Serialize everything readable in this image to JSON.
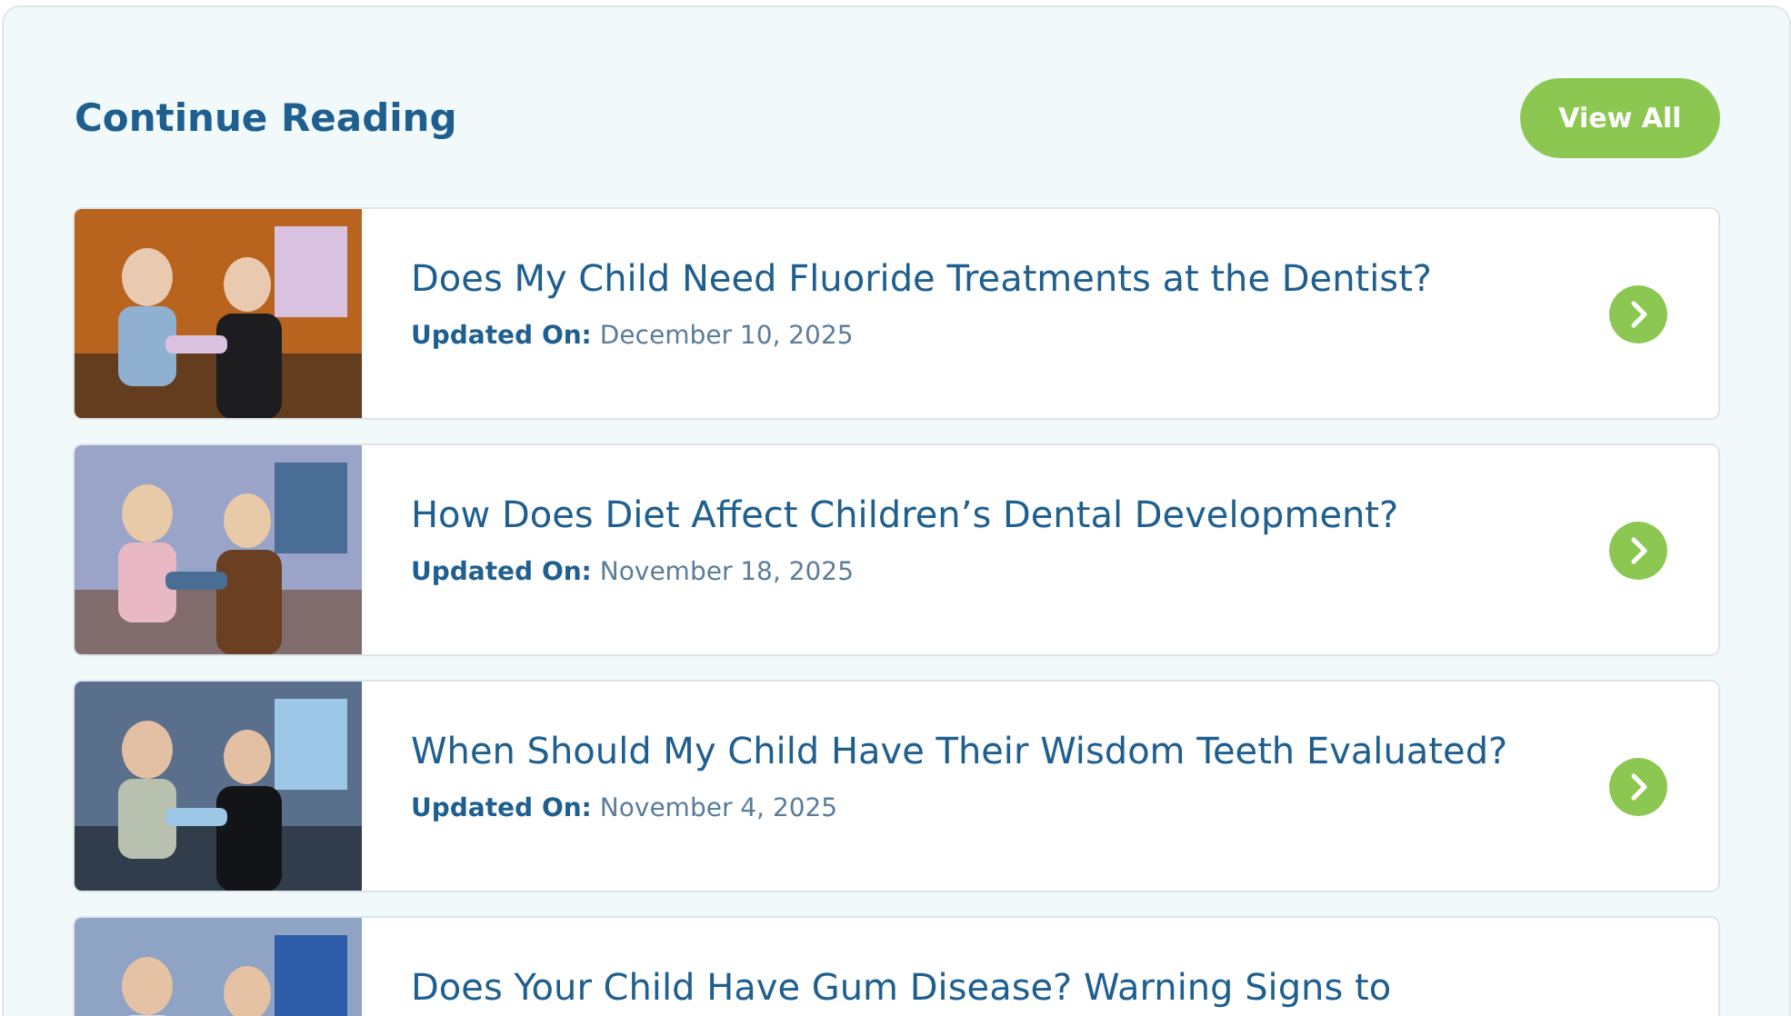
{
  "section": {
    "title": "Continue Reading",
    "button": "View All"
  },
  "articles": [
    {
      "kind": "picture",
      "title": "Does My Child Need Fluoride Treatments at the Dentist?",
      "date_label": "Updated On:",
      "date": "December 10, 2025"
    },
    {
      "kind": "picture",
      "title": "How Does Diet Affect Children’s Dental Development?",
      "date_label": "Updated On:",
      "date": "November 18, 2025"
    },
    {
      "kind": "picture",
      "title": "When Should My Child Have Their Wisdom Teeth Evaluated?",
      "date_label": "Updated On:",
      "date": "November 4, 2025"
    },
    {
      "kind": "picture",
      "title": "Does Your Child Have Gum Disease? Warning Signs to"
    }
  ]
}
